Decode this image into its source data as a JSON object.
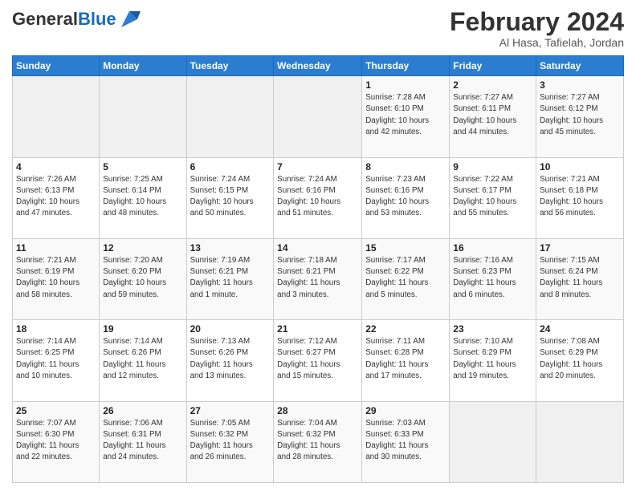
{
  "header": {
    "logo_general": "General",
    "logo_blue": "Blue",
    "month_year": "February 2024",
    "location": "Al Hasa, Tafielah, Jordan"
  },
  "days_of_week": [
    "Sunday",
    "Monday",
    "Tuesday",
    "Wednesday",
    "Thursday",
    "Friday",
    "Saturday"
  ],
  "weeks": [
    [
      {
        "day": "",
        "info": ""
      },
      {
        "day": "",
        "info": ""
      },
      {
        "day": "",
        "info": ""
      },
      {
        "day": "",
        "info": ""
      },
      {
        "day": "1",
        "info": "Sunrise: 7:28 AM\nSunset: 6:10 PM\nDaylight: 10 hours\nand 42 minutes."
      },
      {
        "day": "2",
        "info": "Sunrise: 7:27 AM\nSunset: 6:11 PM\nDaylight: 10 hours\nand 44 minutes."
      },
      {
        "day": "3",
        "info": "Sunrise: 7:27 AM\nSunset: 6:12 PM\nDaylight: 10 hours\nand 45 minutes."
      }
    ],
    [
      {
        "day": "4",
        "info": "Sunrise: 7:26 AM\nSunset: 6:13 PM\nDaylight: 10 hours\nand 47 minutes."
      },
      {
        "day": "5",
        "info": "Sunrise: 7:25 AM\nSunset: 6:14 PM\nDaylight: 10 hours\nand 48 minutes."
      },
      {
        "day": "6",
        "info": "Sunrise: 7:24 AM\nSunset: 6:15 PM\nDaylight: 10 hours\nand 50 minutes."
      },
      {
        "day": "7",
        "info": "Sunrise: 7:24 AM\nSunset: 6:16 PM\nDaylight: 10 hours\nand 51 minutes."
      },
      {
        "day": "8",
        "info": "Sunrise: 7:23 AM\nSunset: 6:16 PM\nDaylight: 10 hours\nand 53 minutes."
      },
      {
        "day": "9",
        "info": "Sunrise: 7:22 AM\nSunset: 6:17 PM\nDaylight: 10 hours\nand 55 minutes."
      },
      {
        "day": "10",
        "info": "Sunrise: 7:21 AM\nSunset: 6:18 PM\nDaylight: 10 hours\nand 56 minutes."
      }
    ],
    [
      {
        "day": "11",
        "info": "Sunrise: 7:21 AM\nSunset: 6:19 PM\nDaylight: 10 hours\nand 58 minutes."
      },
      {
        "day": "12",
        "info": "Sunrise: 7:20 AM\nSunset: 6:20 PM\nDaylight: 10 hours\nand 59 minutes."
      },
      {
        "day": "13",
        "info": "Sunrise: 7:19 AM\nSunset: 6:21 PM\nDaylight: 11 hours\nand 1 minute."
      },
      {
        "day": "14",
        "info": "Sunrise: 7:18 AM\nSunset: 6:21 PM\nDaylight: 11 hours\nand 3 minutes."
      },
      {
        "day": "15",
        "info": "Sunrise: 7:17 AM\nSunset: 6:22 PM\nDaylight: 11 hours\nand 5 minutes."
      },
      {
        "day": "16",
        "info": "Sunrise: 7:16 AM\nSunset: 6:23 PM\nDaylight: 11 hours\nand 6 minutes."
      },
      {
        "day": "17",
        "info": "Sunrise: 7:15 AM\nSunset: 6:24 PM\nDaylight: 11 hours\nand 8 minutes."
      }
    ],
    [
      {
        "day": "18",
        "info": "Sunrise: 7:14 AM\nSunset: 6:25 PM\nDaylight: 11 hours\nand 10 minutes."
      },
      {
        "day": "19",
        "info": "Sunrise: 7:14 AM\nSunset: 6:26 PM\nDaylight: 11 hours\nand 12 minutes."
      },
      {
        "day": "20",
        "info": "Sunrise: 7:13 AM\nSunset: 6:26 PM\nDaylight: 11 hours\nand 13 minutes."
      },
      {
        "day": "21",
        "info": "Sunrise: 7:12 AM\nSunset: 6:27 PM\nDaylight: 11 hours\nand 15 minutes."
      },
      {
        "day": "22",
        "info": "Sunrise: 7:11 AM\nSunset: 6:28 PM\nDaylight: 11 hours\nand 17 minutes."
      },
      {
        "day": "23",
        "info": "Sunrise: 7:10 AM\nSunset: 6:29 PM\nDaylight: 11 hours\nand 19 minutes."
      },
      {
        "day": "24",
        "info": "Sunrise: 7:08 AM\nSunset: 6:29 PM\nDaylight: 11 hours\nand 20 minutes."
      }
    ],
    [
      {
        "day": "25",
        "info": "Sunrise: 7:07 AM\nSunset: 6:30 PM\nDaylight: 11 hours\nand 22 minutes."
      },
      {
        "day": "26",
        "info": "Sunrise: 7:06 AM\nSunset: 6:31 PM\nDaylight: 11 hours\nand 24 minutes."
      },
      {
        "day": "27",
        "info": "Sunrise: 7:05 AM\nSunset: 6:32 PM\nDaylight: 11 hours\nand 26 minutes."
      },
      {
        "day": "28",
        "info": "Sunrise: 7:04 AM\nSunset: 6:32 PM\nDaylight: 11 hours\nand 28 minutes."
      },
      {
        "day": "29",
        "info": "Sunrise: 7:03 AM\nSunset: 6:33 PM\nDaylight: 11 hours\nand 30 minutes."
      },
      {
        "day": "",
        "info": ""
      },
      {
        "day": "",
        "info": ""
      }
    ]
  ]
}
